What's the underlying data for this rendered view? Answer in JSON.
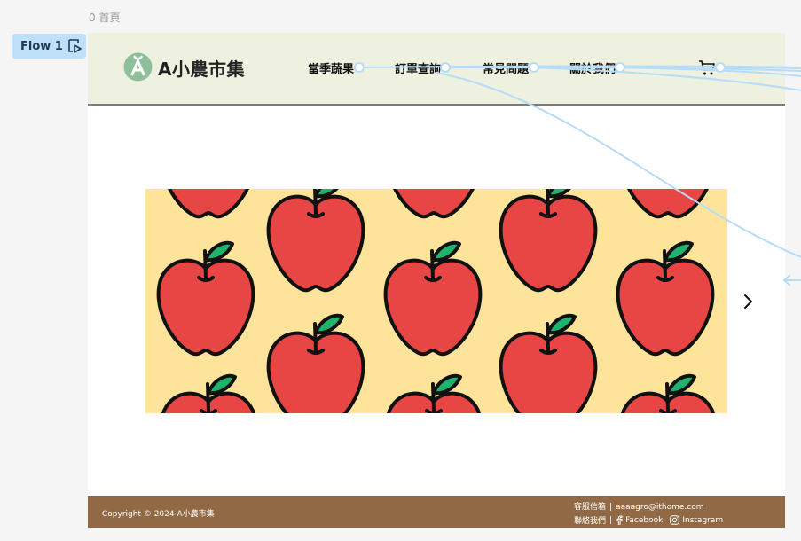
{
  "canvas": {
    "frame_label": "0 首頁",
    "flow_label": "Flow 1"
  },
  "header": {
    "logo_text": "A小農市集",
    "nav": [
      "當季蔬果",
      "訂單查詢",
      "常見問題",
      "關於我們"
    ]
  },
  "banner": {
    "icon": "apple-pattern",
    "background": "#fde49a",
    "apple_color": "#e84545",
    "leaf_color": "#1fb46e"
  },
  "footer": {
    "copyright": "Copyright © 2024 A小農市集",
    "service_label": "客服信箱",
    "email": "aaaagro@ithome.com",
    "contact_label": "聯絡我們",
    "facebook": "Facebook",
    "instagram": "Instagram"
  },
  "colors": {
    "header_bg": "#eef0e0",
    "footer_bg": "#916a45",
    "logo_green": "#8fbf9a",
    "flow_blue": "#bfe0fb"
  }
}
